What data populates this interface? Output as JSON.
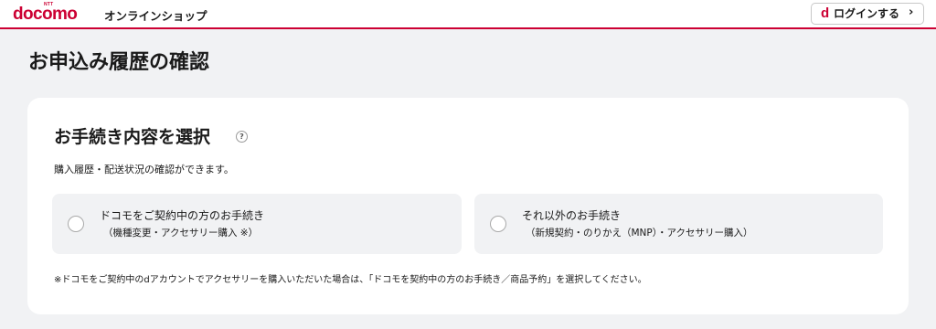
{
  "header": {
    "logo_ntt": "NTT",
    "logo_text": "docomo",
    "logo_sub": "オンラインショップ",
    "login_d": "d",
    "login_label": "ログインする",
    "login_chevron": "›"
  },
  "page": {
    "title": "お申込み履歴の確認"
  },
  "card": {
    "section_title": "お手続き内容を選択",
    "help_icon": "?",
    "description": "購入履歴・配送状況の確認ができます。",
    "options": [
      {
        "label": "ドコモをご契約中の方のお手続き",
        "sub": "（機種変更・アクセサリー購入 ※）",
        "selected": false
      },
      {
        "label": "それ以外のお手続き",
        "sub": "（新規契約・のりかえ（MNP）・アクセサリー購入）",
        "selected": false
      }
    ],
    "note": "※ドコモをご契約中のdアカウントでアクセサリーを購入いただいた場合は、「ドコモを契約中の方のお手続き／商品予約」を選択してください。"
  },
  "colors": {
    "brand": "#cc0033",
    "background": "#f1f2f4",
    "card": "#ffffff",
    "option_bg": "#f1f2f4"
  }
}
